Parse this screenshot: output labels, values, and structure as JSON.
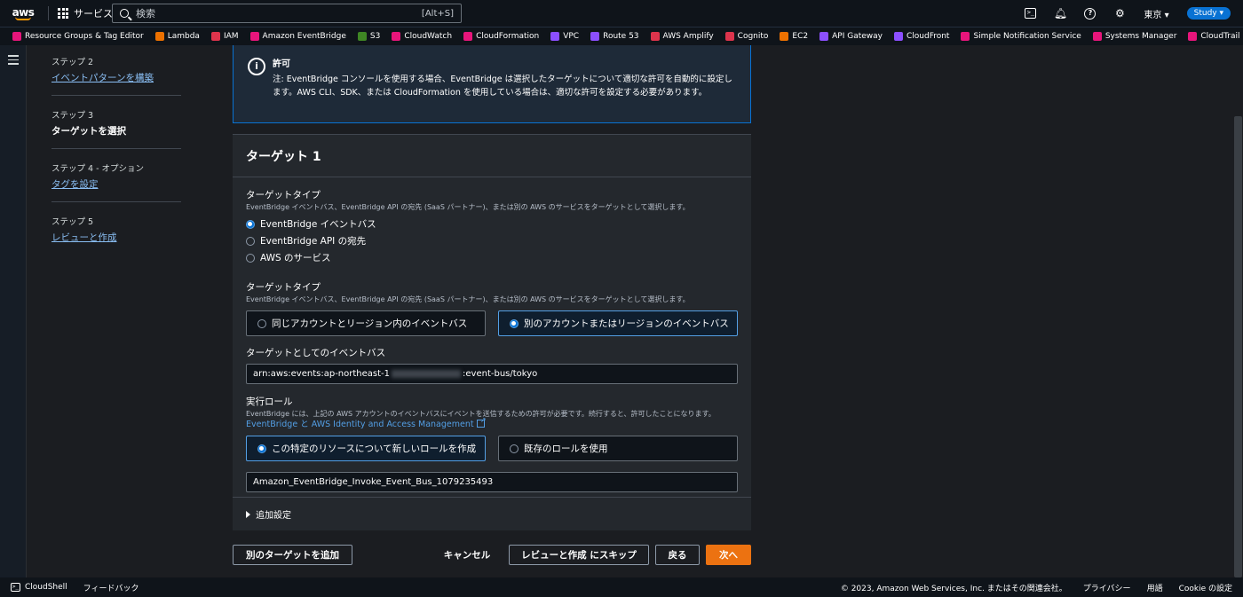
{
  "topnav": {
    "logo": "aws",
    "services": "サービス",
    "search_placeholder": "検索",
    "search_hint": "[Alt+S]",
    "region": "東京 ▾",
    "account": "Study ▾"
  },
  "favorites": [
    {
      "label": "Resource Groups & Tag Editor",
      "color": "#e7157b"
    },
    {
      "label": "Lambda",
      "color": "#ed7100"
    },
    {
      "label": "IAM",
      "color": "#dd344c"
    },
    {
      "label": "Amazon EventBridge",
      "color": "#e7157b"
    },
    {
      "label": "S3",
      "color": "#3f8624"
    },
    {
      "label": "CloudWatch",
      "color": "#e7157b"
    },
    {
      "label": "CloudFormation",
      "color": "#e7157b"
    },
    {
      "label": "VPC",
      "color": "#8c4fff"
    },
    {
      "label": "Route 53",
      "color": "#8c4fff"
    },
    {
      "label": "AWS Amplify",
      "color": "#dd344c"
    },
    {
      "label": "Cognito",
      "color": "#dd344c"
    },
    {
      "label": "EC2",
      "color": "#ed7100"
    },
    {
      "label": "API Gateway",
      "color": "#8c4fff"
    },
    {
      "label": "CloudFront",
      "color": "#8c4fff"
    },
    {
      "label": "Simple Notification Service",
      "color": "#e7157b"
    },
    {
      "label": "Systems Manager",
      "color": "#e7157b"
    },
    {
      "label": "CloudTrail",
      "color": "#e7157b"
    }
  ],
  "steps": [
    {
      "num": "ステップ 2",
      "label": "イベントパターンを構築",
      "state": "link"
    },
    {
      "num": "ステップ 3",
      "label": "ターゲットを選択",
      "state": "current"
    },
    {
      "num": "ステップ 4 - オプション",
      "label": "タグを設定",
      "state": "link"
    },
    {
      "num": "ステップ 5",
      "label": "レビューと作成",
      "state": "link"
    }
  ],
  "info": {
    "title": "許可",
    "text": "注: EventBridge コンソールを使用する場合、EventBridge は選択したターゲットについて適切な許可を自動的に設定します。AWS CLI、SDK、または CloudFormation を使用している場合は、適切な許可を設定する必要があります。"
  },
  "target": {
    "title": "ターゲット 1",
    "type_label": "ターゲットタイプ",
    "type_desc": "EventBridge イベントバス、EventBridge API の宛先 (SaaS パートナー)、または別の AWS のサービスをターゲットとして選択します。",
    "type_options": [
      "EventBridge イベントバス",
      "EventBridge API の宛先",
      "AWS のサービス"
    ],
    "type_selected": 0,
    "bus_type_label": "ターゲットタイプ",
    "bus_type_desc": "EventBridge イベントバス、EventBridge API の宛先 (SaaS パートナー)、または別の AWS のサービスをターゲットとして選択します。",
    "bus_tiles": [
      "同じアカウントとリージョン内のイベントバス",
      "別のアカウントまたはリージョンのイベントバス"
    ],
    "bus_selected": 1,
    "bus_arn_label": "ターゲットとしてのイベントバス",
    "bus_arn_prefix": "arn:aws:events:ap-northeast-1",
    "bus_arn_suffix": ":event-bus/tokyo",
    "role_label": "実行ロール",
    "role_desc": "EventBridge には、上記の AWS アカウントのイベントバスにイベントを送信するための許可が必要です。続行すると、許可したことになります。",
    "role_link": "EventBridge と AWS Identity and Access Management",
    "role_tiles": [
      "この特定のリソースについて新しいロールを作成",
      "既存のロールを使用"
    ],
    "role_selected": 0,
    "role_name": "Amazon_EventBridge_Invoke_Event_Bus_1079235493",
    "additional": "追加設定"
  },
  "buttons": {
    "add_target": "別のターゲットを追加",
    "cancel": "キャンセル",
    "skip": "レビューと作成 にスキップ",
    "back": "戻る",
    "next": "次へ"
  },
  "footer": {
    "cloudshell": "CloudShell",
    "feedback": "フィードバック",
    "copyright": "© 2023, Amazon Web Services, Inc. またはその関連会社。",
    "privacy": "プライバシー",
    "terms": "用語",
    "cookie": "Cookie の設定"
  }
}
